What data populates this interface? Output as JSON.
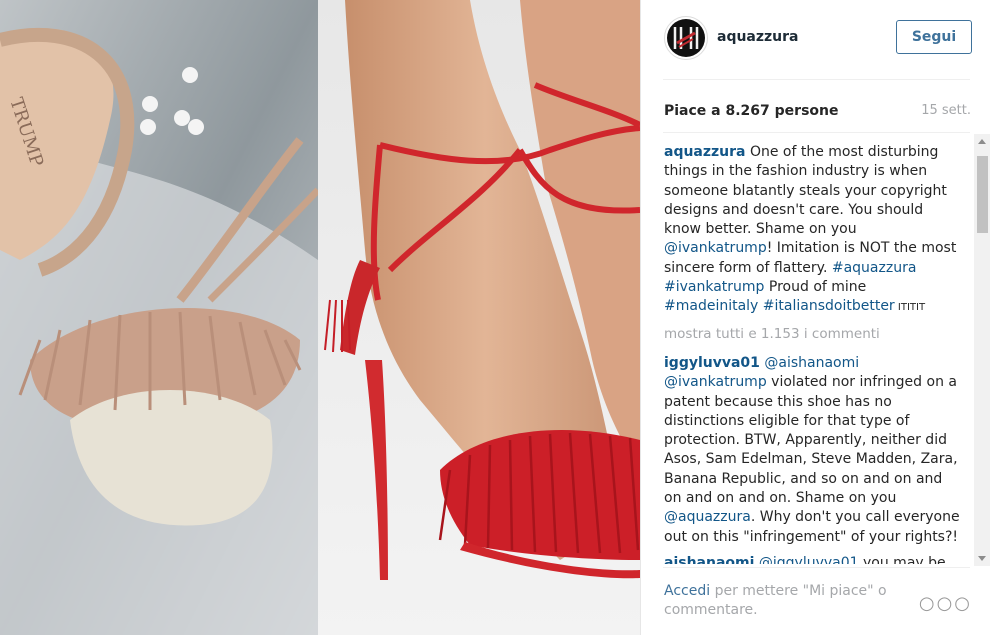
{
  "post": {
    "username": "aquazzura",
    "follow_label": "Segui",
    "likes": "Piace a 8.267 persone",
    "date": "15 sett."
  },
  "caption": {
    "user": "aquazzura",
    "text_1": " One of the most disturbing things in the fashion industry is when someone blatantly steals your copyright designs and doesn't care. You should know better. Shame on you ",
    "mention_1": "@ivankatrump",
    "text_2": "! Imitation is NOT the most sincere form of flattery. ",
    "hashtag_1": "#aquazzura",
    "text_3": " ",
    "mention_2": "#ivankatrump",
    "text_4": " Proud of mine ",
    "hashtag_2": "#madeinitaly",
    "text_5": " ",
    "hashtag_3": "#italiansdoitbetter",
    "text_6": " ITITIT"
  },
  "more_comments": "mostra tutti e 1.153 i commenti",
  "comments": [
    {
      "user": "iggyluvva01",
      "mention_a": "@aishanaomi",
      "mention_b": "@ivankatrump",
      "text": " violated nor infringed on a patent because this shoe has no distinctions eligible for that type of protection. BTW, Apparently, neither did Asos, Sam Edelman, Steve Madden, Zara, Banana Republic, and so on and on and on and on and on. Shame on you ",
      "mention_c": "@aquazzura",
      "text_end": ". Why don't you call everyone out on this \"infringement\" of your rights?!"
    },
    {
      "user": "aishanaomi",
      "mention_a": "@iggyluvva01",
      "text": " you may be"
    }
  ],
  "footer": {
    "login": "Accedi",
    "rest": " per mettere \"Mi piace\" o commentare.",
    "more_icon": "ellipsis-icon",
    "more_symbol": "○○○"
  },
  "colors": {
    "link": "#125688",
    "follow": "#3f729b",
    "muted": "#a5a7aa"
  }
}
